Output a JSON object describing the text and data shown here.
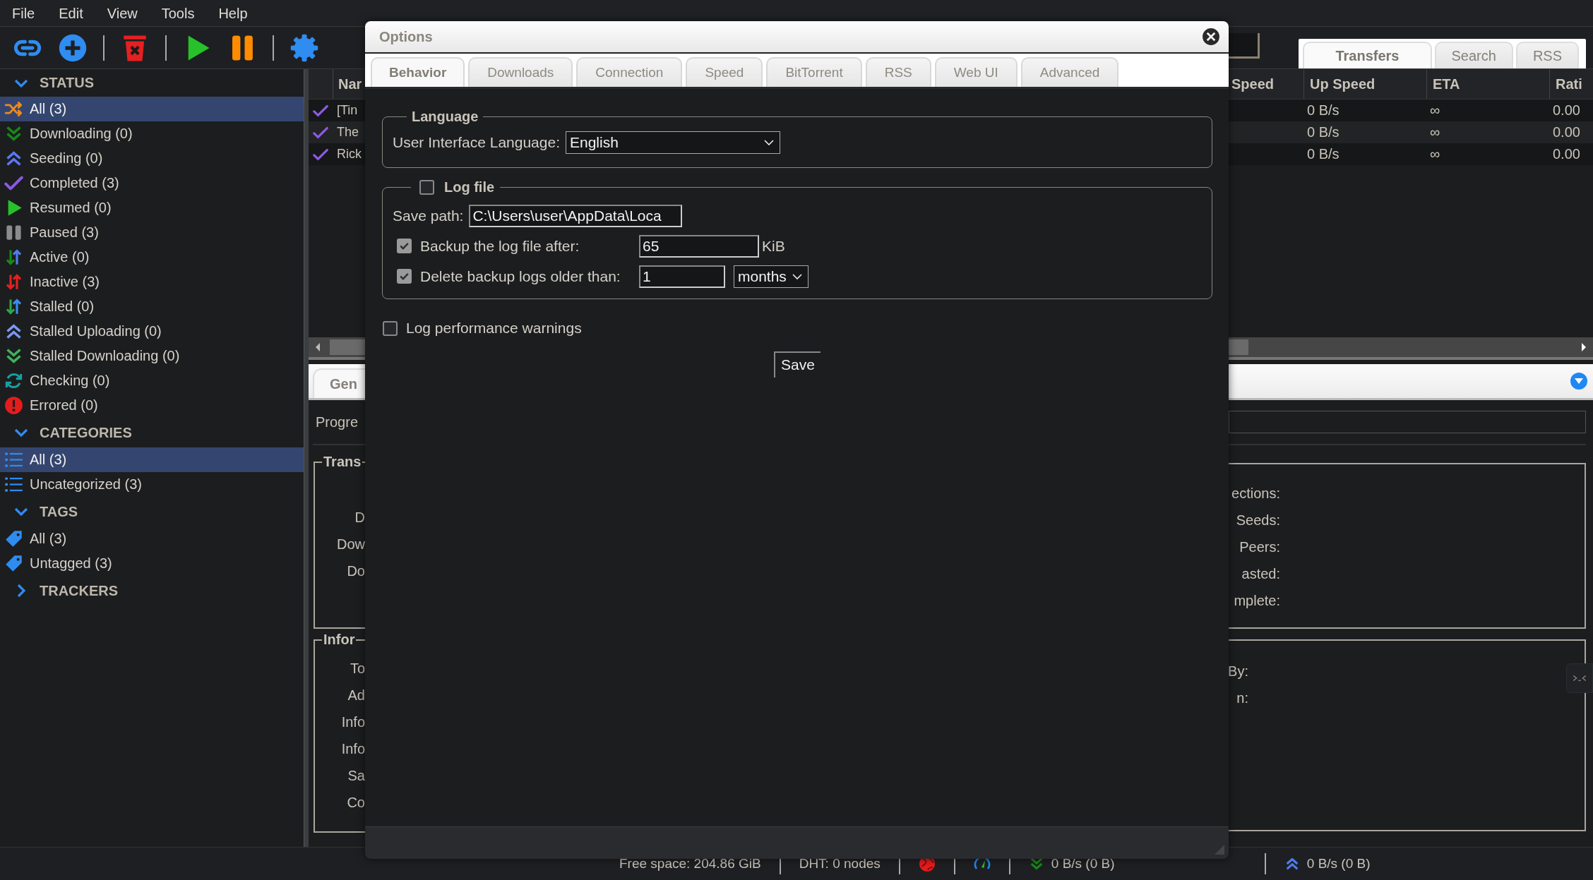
{
  "menu": [
    "File",
    "Edit",
    "View",
    "Tools",
    "Help"
  ],
  "sidebar": {
    "sections": [
      {
        "title": "STATUS",
        "expanded": true,
        "items": [
          {
            "label": "All (3)",
            "kind": "all",
            "selected": true
          },
          {
            "label": "Downloading (0)",
            "kind": "downloading",
            "selected": false
          },
          {
            "label": "Seeding (0)",
            "kind": "seeding",
            "selected": false
          },
          {
            "label": "Completed (3)",
            "kind": "completed",
            "selected": false
          },
          {
            "label": "Resumed (0)",
            "kind": "resumed",
            "selected": false
          },
          {
            "label": "Paused (3)",
            "kind": "paused",
            "selected": false
          },
          {
            "label": "Active (0)",
            "kind": "active",
            "selected": false
          },
          {
            "label": "Inactive (3)",
            "kind": "inactive",
            "selected": false
          },
          {
            "label": "Stalled (0)",
            "kind": "stalled",
            "selected": false
          },
          {
            "label": "Stalled Uploading (0)",
            "kind": "stalled_up",
            "selected": false
          },
          {
            "label": "Stalled Downloading (0)",
            "kind": "stalled_down",
            "selected": false
          },
          {
            "label": "Checking (0)",
            "kind": "checking",
            "selected": false
          },
          {
            "label": "Errored (0)",
            "kind": "errored",
            "selected": false
          }
        ]
      },
      {
        "title": "CATEGORIES",
        "expanded": true,
        "items": [
          {
            "label": "All (3)",
            "kind": "category",
            "selected": true
          },
          {
            "label": "Uncategorized (3)",
            "kind": "category",
            "selected": false
          }
        ]
      },
      {
        "title": "TAGS",
        "expanded": true,
        "items": [
          {
            "label": "All (3)",
            "kind": "tag",
            "selected": false
          },
          {
            "label": "Untagged (3)",
            "kind": "tag",
            "selected": false
          }
        ]
      },
      {
        "title": "TRACKERS",
        "expanded": false
      }
    ]
  },
  "main_tabs": [
    {
      "label": "Transfers",
      "selected": true
    },
    {
      "label": "Search",
      "selected": false
    },
    {
      "label": "RSS",
      "selected": false
    }
  ],
  "table": {
    "columns": [
      "Nar",
      "Speed",
      "Up Speed",
      "ETA",
      "Rati"
    ],
    "rows": [
      {
        "kind": "completed",
        "name": "[Tin",
        "up_speed": "0 B/s",
        "eta": "∞",
        "ratio": "0.00"
      },
      {
        "kind": "completed",
        "name": "The",
        "up_speed": "0 B/s",
        "eta": "∞",
        "ratio": "0.00"
      },
      {
        "kind": "completed",
        "name": "Rick",
        "up_speed": "0 B/s",
        "eta": "∞",
        "ratio": "0.00"
      }
    ]
  },
  "details": {
    "tab": "Gen",
    "progress_label": "Progre",
    "progress": {
      "level": 0
    },
    "transfer": {
      "legend": "Trans",
      "rows": [
        {
          "right": "ections:"
        },
        {
          "left": "D",
          "right": "Seeds:"
        },
        {
          "left": "Dow",
          "right": "Peers:"
        },
        {
          "left": "Do",
          "right": "asted:"
        },
        {
          "right": "mplete:"
        }
      ]
    },
    "information": {
      "legend": "Infor",
      "rows": [
        {
          "left": "To",
          "right": "By:"
        },
        {
          "left": "Ad",
          "right": "n:"
        },
        {
          "left": "Info"
        },
        {
          "left": "Info"
        },
        {
          "left": "Sa"
        },
        {
          "left": "Co"
        }
      ]
    }
  },
  "dialog": {
    "title": "Options",
    "tabs": [
      {
        "label": "Behavior",
        "selected": true
      },
      {
        "label": "Downloads",
        "selected": false
      },
      {
        "label": "Connection",
        "selected": false
      },
      {
        "label": "Speed",
        "selected": false
      },
      {
        "label": "BitTorrent",
        "selected": false
      },
      {
        "label": "RSS",
        "selected": false
      },
      {
        "label": "Web UI",
        "selected": false
      },
      {
        "label": "Advanced",
        "selected": false
      }
    ],
    "language": {
      "legend": "Language",
      "label": "User Interface Language:",
      "value": "English"
    },
    "log_file": {
      "legend": "Log file",
      "checked": false,
      "save_path_label": "Save path:",
      "save_path": "C:\\Users\\user\\AppData\\Loca",
      "backup": {
        "label": "Backup the log file after:",
        "checked": true,
        "disabled": true,
        "value": "65",
        "unit": "KiB"
      },
      "delete": {
        "label": "Delete backup logs older than:",
        "checked": true,
        "disabled": true,
        "value": "1",
        "unit": "months"
      }
    },
    "perf_warnings": {
      "label": "Log performance warnings",
      "checked": false
    },
    "save": "Save"
  },
  "status_bar": {
    "free_space": "Free space: 204.86 GiB",
    "dht": "DHT: 0 nodes",
    "download": "0 B/s (0 B)",
    "upload": "0 B/s (0 B)"
  }
}
